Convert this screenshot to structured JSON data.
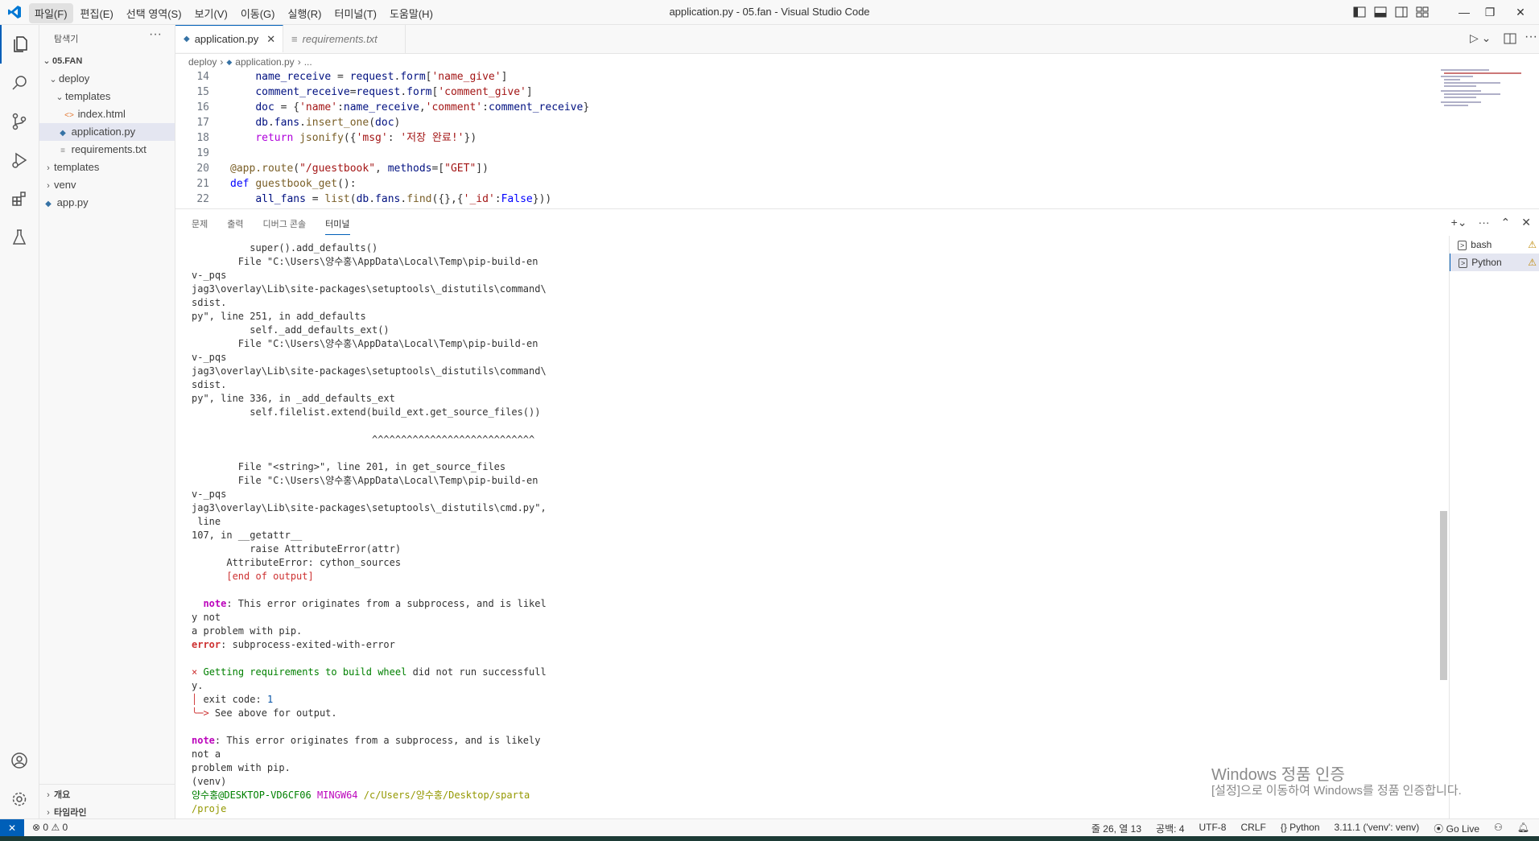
{
  "titlebar": {
    "menus": [
      "파일(F)",
      "편집(E)",
      "선택 영역(S)",
      "보기(V)",
      "이동(G)",
      "실행(R)",
      "터미널(T)",
      "도움말(H)"
    ],
    "title": "application.py - 05.fan - Visual Studio Code"
  },
  "sidebar": {
    "title": "탐색기",
    "more": "···",
    "root": "05.FAN",
    "items": [
      {
        "label": "deploy",
        "type": "folder-open"
      },
      {
        "label": "templates",
        "type": "folder-open"
      },
      {
        "label": "index.html",
        "type": "html"
      },
      {
        "label": "application.py",
        "type": "python"
      },
      {
        "label": "requirements.txt",
        "type": "text"
      },
      {
        "label": "templates",
        "type": "folder"
      },
      {
        "label": "venv",
        "type": "folder"
      },
      {
        "label": "app.py",
        "type": "python"
      }
    ],
    "outline": "개요",
    "timeline": "타임라인"
  },
  "tabs": [
    {
      "label": "application.py",
      "active": true
    },
    {
      "label": "requirements.txt",
      "active": false
    }
  ],
  "breadcrumb": [
    "deploy",
    "application.py",
    "..."
  ],
  "panel": {
    "tabs": [
      "문제",
      "출력",
      "디버그 콘솔",
      "터미널"
    ],
    "active_tab": "터미널",
    "terminals": [
      "bash",
      "Python"
    ]
  },
  "watermark": {
    "line1": "Windows 정품 인증",
    "line2": "[설정]으로 이동하여 Windows를 정품 인증합니다."
  },
  "statusbar": {
    "errors": "0",
    "warnings": "0",
    "position": "줄 26, 열 13",
    "spaces": "공백: 4",
    "encoding": "UTF-8",
    "eol": "CRLF",
    "language": "Python",
    "interpreter": "3.11.1 ('venv': venv)",
    "golive": "Go Live"
  }
}
